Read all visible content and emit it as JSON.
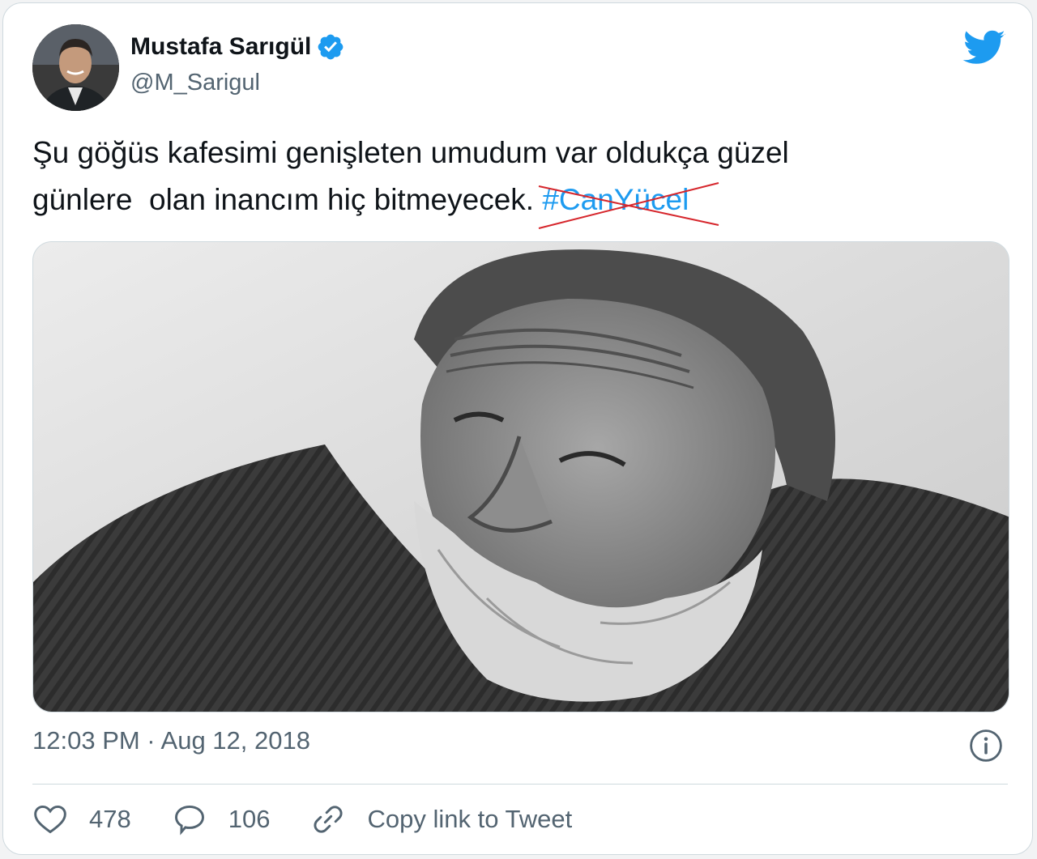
{
  "tweet": {
    "author": {
      "display_name": "Mustafa Sarıgül",
      "handle": "@M_Sarigul",
      "verified": true
    },
    "text_before_hashtag": "Şu göğüs kafesimi genişleten umudum var oldukça güzel\ngünlere  olan inancım hiç bitmeyecek. ",
    "hashtag": "#CanYücel",
    "hashtag_struck_through": true,
    "timestamp": "12:03 PM · Aug 12, 2018",
    "actions": {
      "likes": "478",
      "replies": "106",
      "copy_link_label": "Copy link to Tweet"
    }
  },
  "icons": {
    "brand": "twitter-bird-icon",
    "verified": "verified-badge-icon",
    "info": "info-icon",
    "like": "heart-icon",
    "reply": "speech-bubble-icon",
    "link": "link-icon"
  },
  "colors": {
    "accent": "#1d9bf0",
    "text": "#0f1419",
    "secondary_text": "#536471",
    "strike": "#d6262c",
    "border": "#cfd9de"
  }
}
